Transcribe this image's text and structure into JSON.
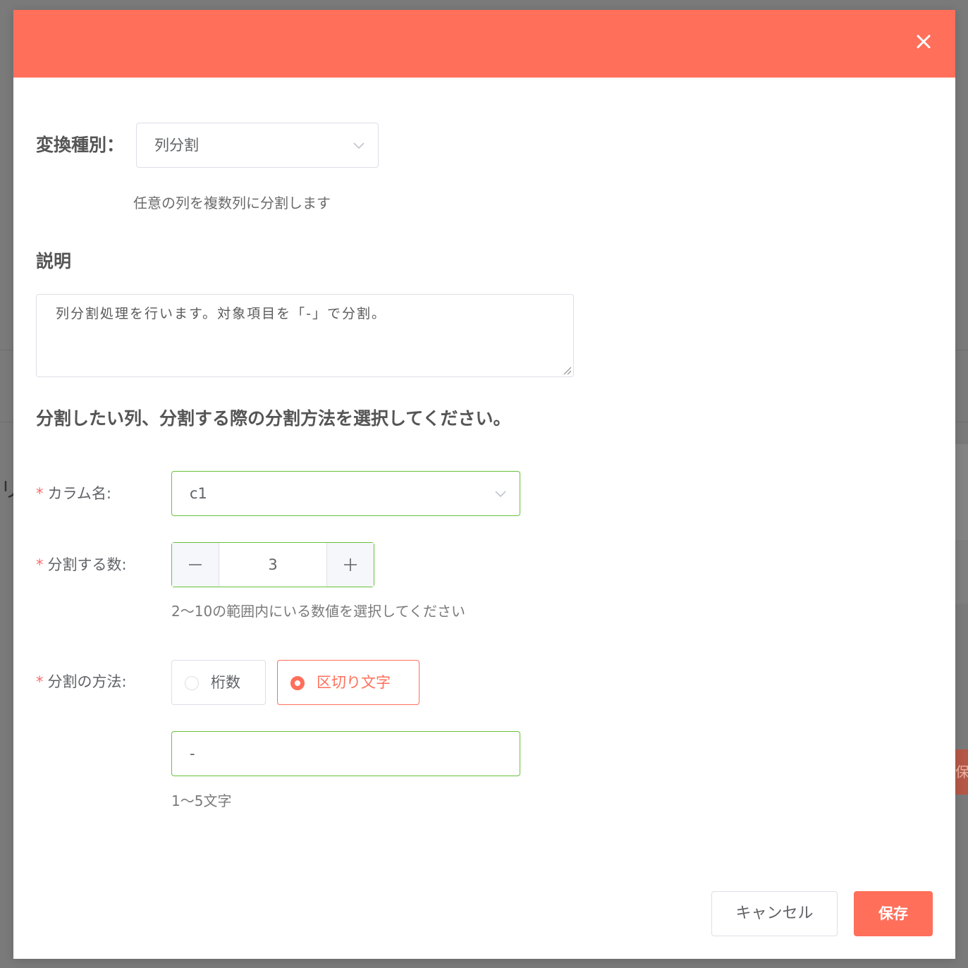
{
  "background": {
    "peek_text": "リ",
    "peek_button": "保"
  },
  "dialog": {
    "close_icon": "close-icon",
    "transform_type": {
      "label": "変換種別：",
      "selected": "列分割",
      "description": "任意の列を複数列に分割します"
    },
    "description": {
      "label": "説明",
      "value": "列分割処理を行います。対象項目を「-」で分割。"
    },
    "section_title": "分割したい列、分割する際の分割方法を選択してください。",
    "column": {
      "required": "*",
      "label": "カラム名:",
      "selected": "c1"
    },
    "split_count": {
      "required": "*",
      "label": "分割する数:",
      "value": "3",
      "hint": "2〜10の範囲内にいる数値を選択してください"
    },
    "split_method": {
      "required": "*",
      "label": "分割の方法:",
      "options": [
        "桁数",
        "区切り文字"
      ],
      "selected": "区切り文字",
      "delimiter_value": "-",
      "delimiter_hint": "1〜5文字"
    },
    "footer": {
      "cancel_label": "キャンセル",
      "save_label": "保存"
    }
  },
  "colors": {
    "accent": "#ff6f5a",
    "valid_border": "#67c23a",
    "required": "#f56c6c"
  }
}
